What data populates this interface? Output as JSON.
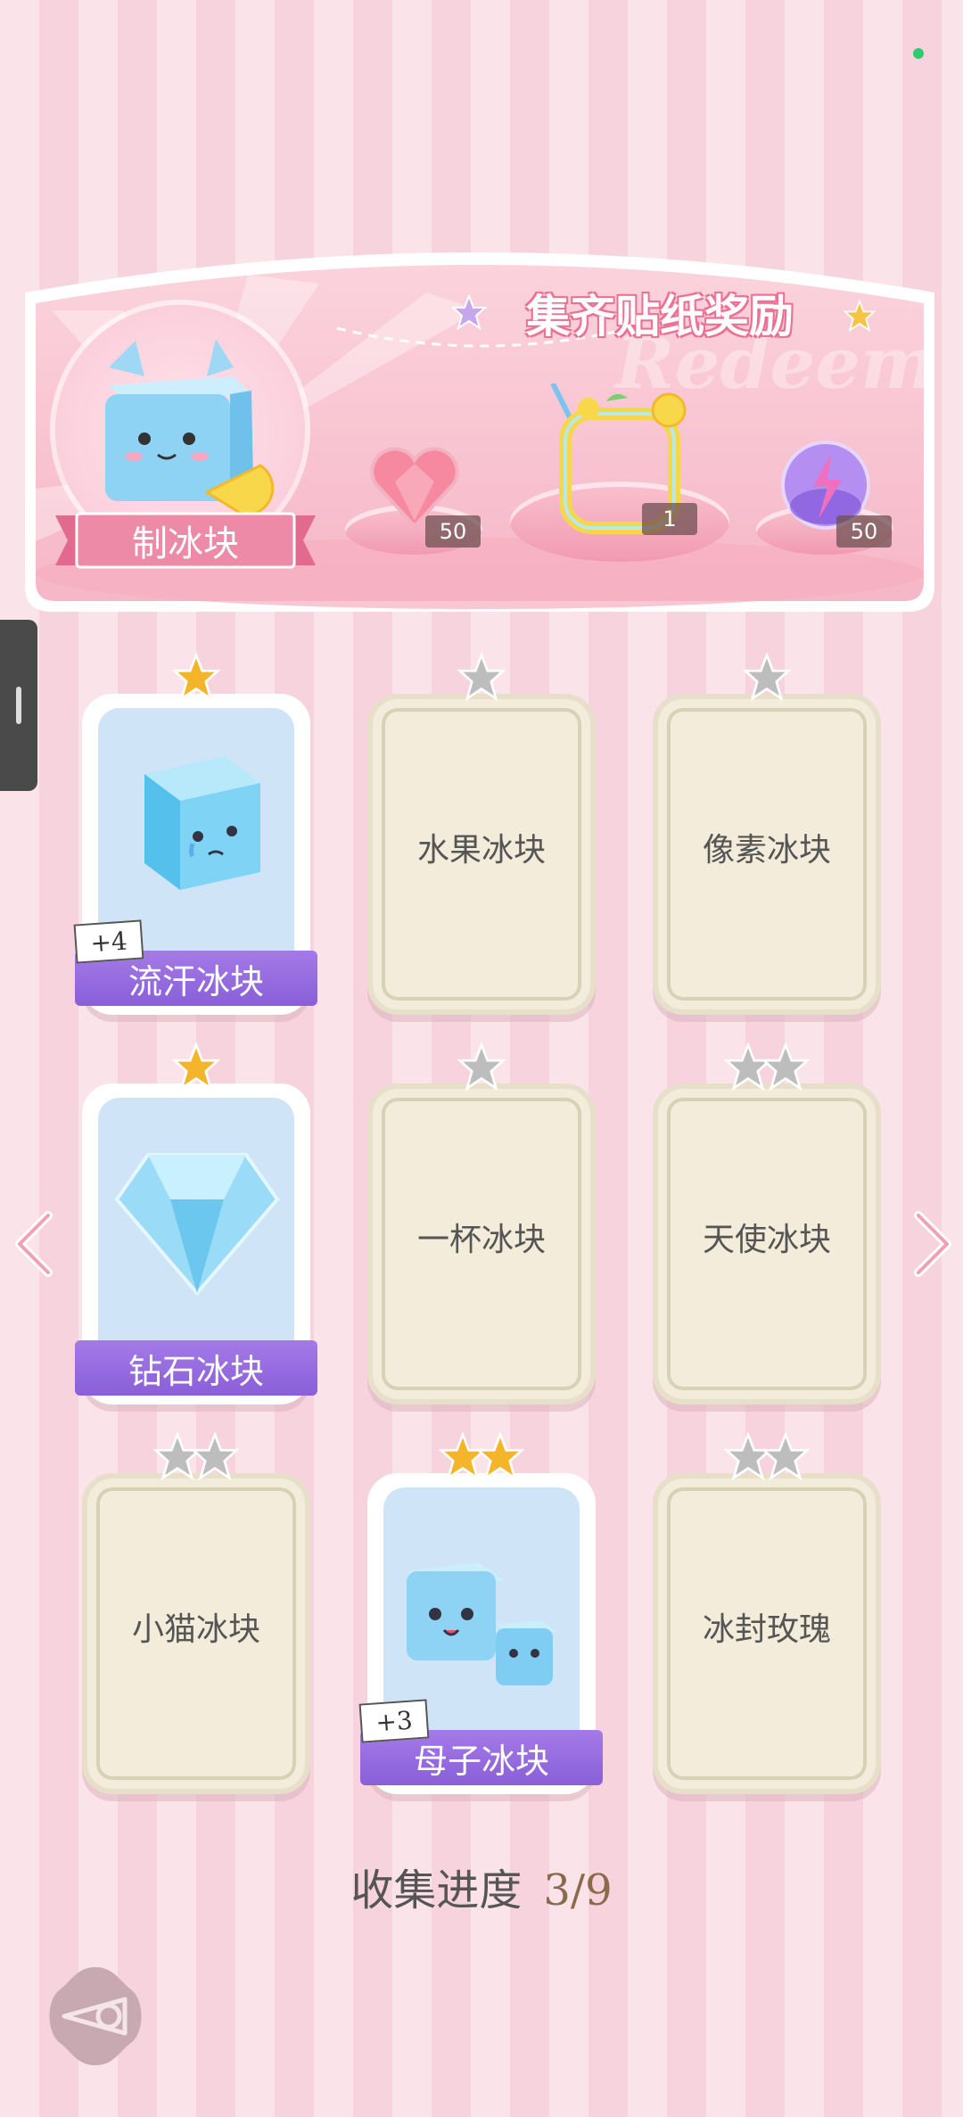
{
  "banner": {
    "title": "集齐贴纸奖励",
    "watermark": "Redeem",
    "make_label": "制冰块",
    "rewards": [
      {
        "name": "heart-gem",
        "qty": "50"
      },
      {
        "name": "lemon-drink-frame",
        "qty": "1"
      },
      {
        "name": "purple-orb",
        "qty": "50"
      }
    ]
  },
  "cards": [
    {
      "name": "流汗冰块",
      "owned": true,
      "stars": 1,
      "star_color": "gold",
      "badge": "+4"
    },
    {
      "name": "水果冰块",
      "owned": false,
      "stars": 1,
      "star_color": "silver"
    },
    {
      "name": "像素冰块",
      "owned": false,
      "stars": 1,
      "star_color": "silver"
    },
    {
      "name": "钻石冰块",
      "owned": true,
      "stars": 1,
      "star_color": "gold"
    },
    {
      "name": "一杯冰块",
      "owned": false,
      "stars": 1,
      "star_color": "silver"
    },
    {
      "name": "天使冰块",
      "owned": false,
      "stars": 2,
      "star_color": "silver"
    },
    {
      "name": "小猫冰块",
      "owned": false,
      "stars": 2,
      "star_color": "silver"
    },
    {
      "name": "母子冰块",
      "owned": true,
      "stars": 2,
      "star_color": "gold",
      "badge": "+3"
    },
    {
      "name": "冰封玫瑰",
      "owned": false,
      "stars": 2,
      "star_color": "silver"
    }
  ],
  "progress": {
    "label": "收集进度",
    "value": "3/9"
  },
  "colors": {
    "pink_bg": "#fbe3ea",
    "ribbon_purple": "#8a5fd8",
    "gold_star": "#f4b52a",
    "status_dot": "#2ecc71"
  }
}
